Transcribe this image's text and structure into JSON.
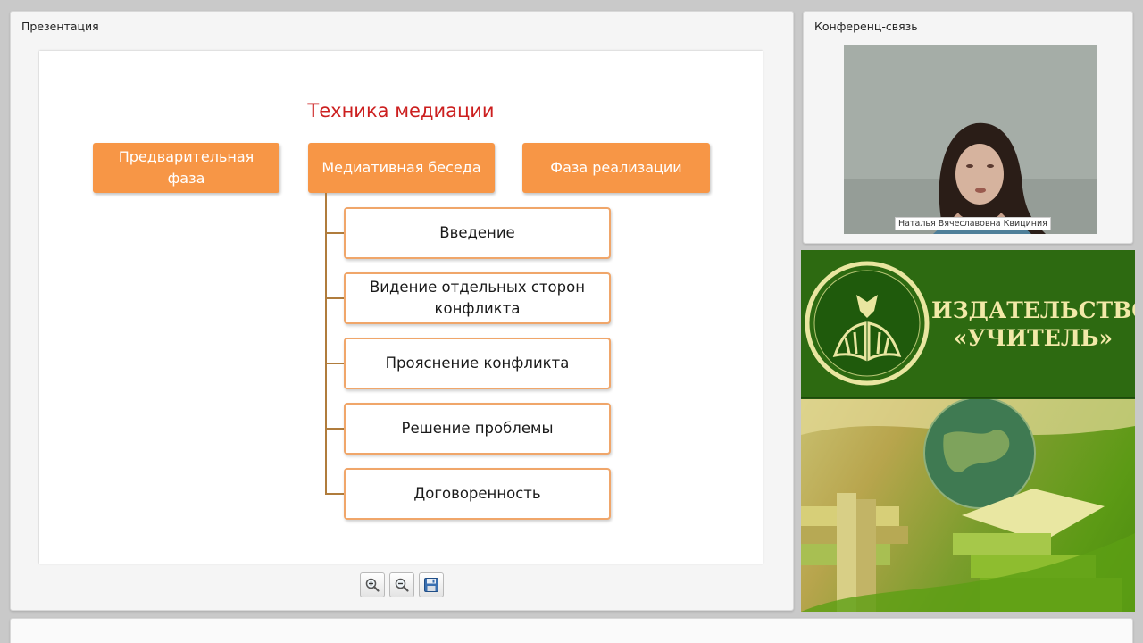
{
  "presentation": {
    "panel_title": "Презентация",
    "slide": {
      "title": "Техника медиации",
      "phases": [
        "Предварительная фаза",
        "Медиативная беседа",
        "Фаза реализации"
      ],
      "steps": [
        "Введение",
        "Видение отдельных сторон конфликта",
        "Прояснение конфликта",
        "Решение проблемы",
        "Договоренность"
      ]
    },
    "toolbar": {
      "zoom_in_icon": "zoom-in-icon",
      "zoom_out_icon": "zoom-out-icon",
      "save_icon": "floppy-disk-icon"
    }
  },
  "conference": {
    "panel_title": "Конференц-связь",
    "speaker_name": "Наталья Вячеславовна Квициния"
  },
  "banner": {
    "publisher_line1": "ИЗДАТЕЛЬСТВО",
    "publisher_line2": "«УЧИТЕЛЬ»"
  },
  "colors": {
    "accent_orange": "#f79646",
    "title_red": "#cc1f1f",
    "banner_green": "#2d6a11"
  }
}
